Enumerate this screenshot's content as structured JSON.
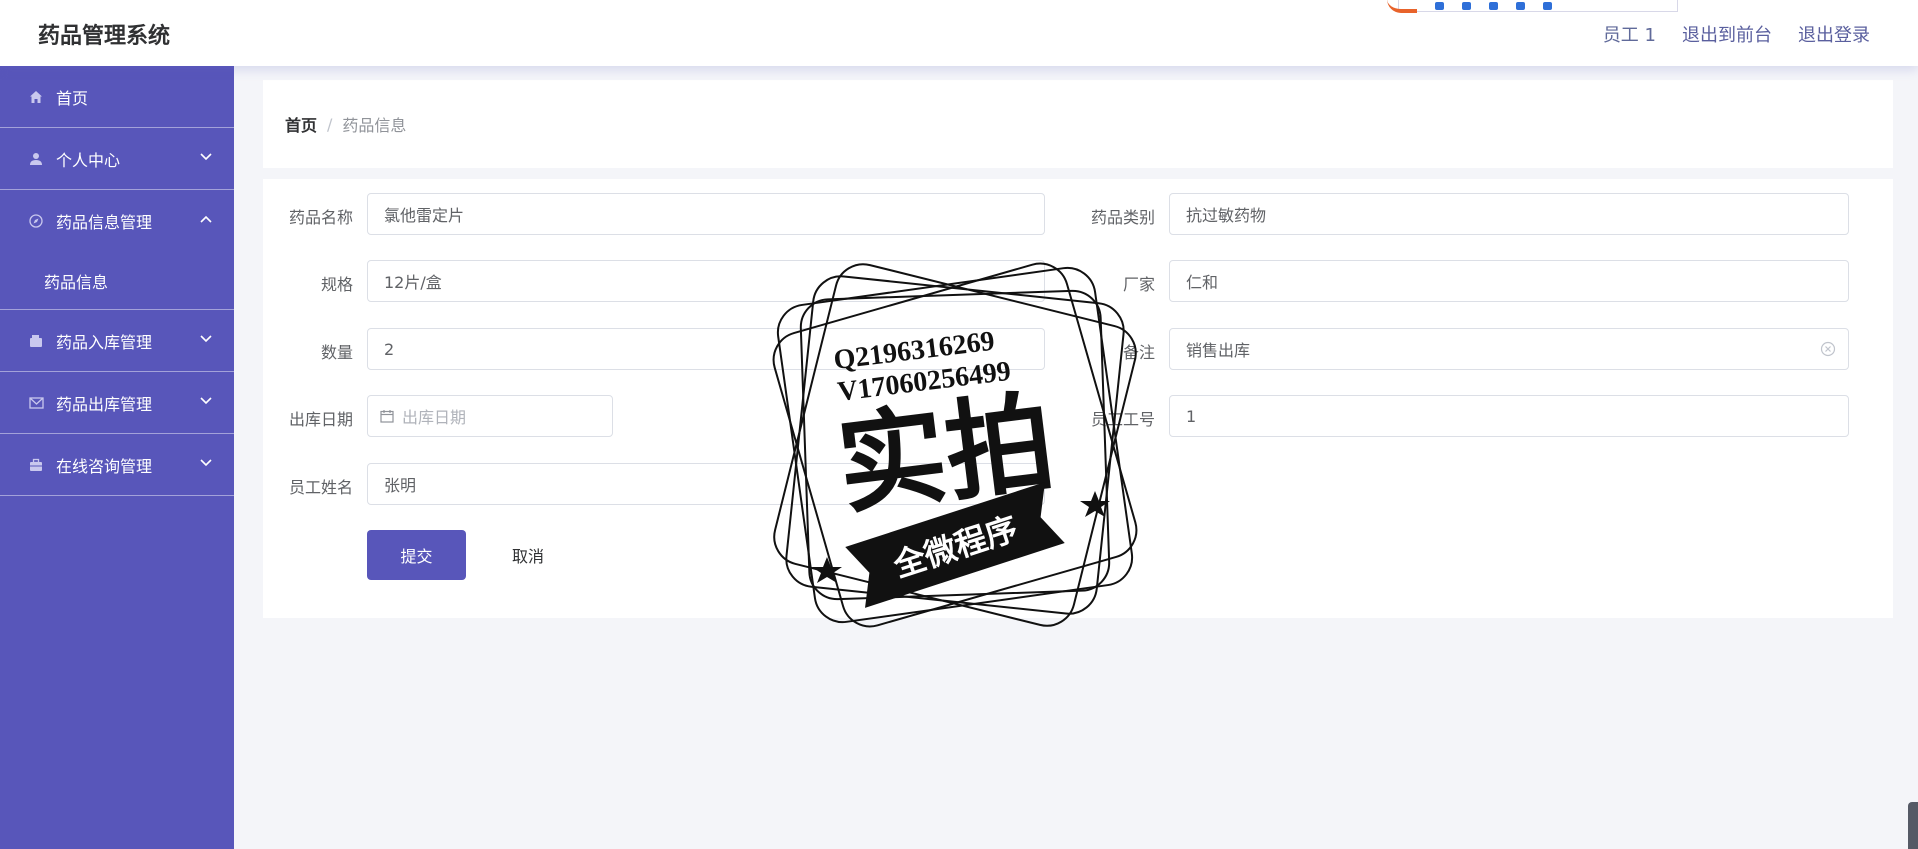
{
  "header": {
    "app_title": "药品管理系统",
    "links": [
      "员工 1",
      "退出到前台",
      "退出登录"
    ]
  },
  "sidebar": {
    "items": [
      {
        "label": "首页",
        "icon": "home-icon"
      },
      {
        "label": "个人中心",
        "icon": "user-icon"
      },
      {
        "label": "药品信息管理",
        "icon": "compass-icon",
        "expanded": true,
        "sub": [
          "药品信息"
        ]
      },
      {
        "label": "药品入库管理",
        "icon": "wallet-icon"
      },
      {
        "label": "药品出库管理",
        "icon": "mail-icon"
      },
      {
        "label": "在线咨询管理",
        "icon": "briefcase-icon"
      }
    ]
  },
  "breadcrumb": {
    "home": "首页",
    "separator": "/",
    "current": "药品信息"
  },
  "form": {
    "drug_name": {
      "label": "药品名称",
      "value": "氯他雷定片"
    },
    "category": {
      "label": "药品类别",
      "value": "抗过敏药物"
    },
    "spec": {
      "label": "规格",
      "value": "12片/盒"
    },
    "manufacturer": {
      "label": "厂家",
      "value": "仁和"
    },
    "quantity": {
      "label": "数量",
      "value": "2"
    },
    "remark": {
      "label": "备注",
      "value": "销售出库"
    },
    "out_date": {
      "label": "出库日期",
      "placeholder": "出库日期"
    },
    "employee_no": {
      "label": "员工工号",
      "value": "1"
    },
    "employee_name": {
      "label": "员工姓名",
      "value": "张明"
    },
    "submit_label": "提交",
    "cancel_label": "取消"
  },
  "watermark": {
    "line1": "Q2196316269",
    "line2": "V17060256499",
    "main": "实拍",
    "banner": "全微程序"
  },
  "colors": {
    "accent": "#5856ba",
    "background": "#f4f5f9"
  }
}
